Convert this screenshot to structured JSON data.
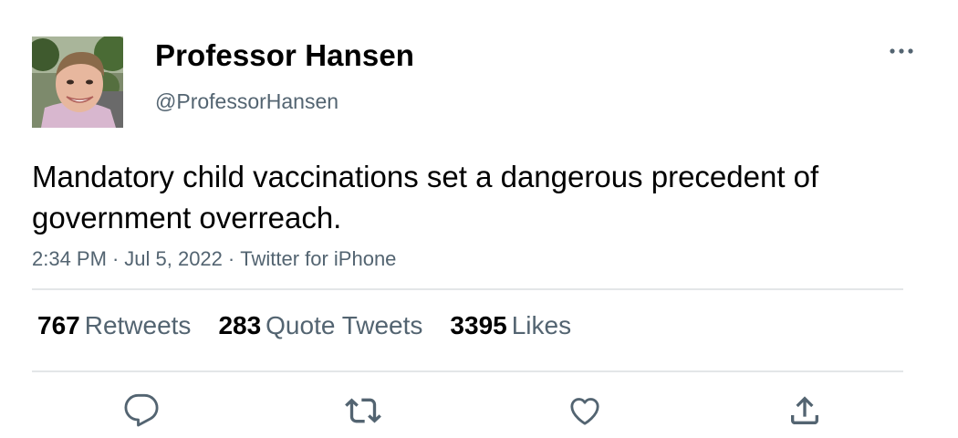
{
  "author": {
    "display_name": "Professor Hansen",
    "handle": "@ProfessorHansen",
    "avatar_icon": "profile-photo"
  },
  "tweet": {
    "text": "Mandatory child vaccinations set a dangerous precedent of government overreach.",
    "time": "2:34 PM",
    "date": "Jul 5, 2022",
    "source": "Twitter for iPhone",
    "separator": "·"
  },
  "stats": {
    "retweets": {
      "count": "767",
      "label": "Retweets"
    },
    "quote_tweets": {
      "count": "283",
      "label": "Quote Tweets"
    },
    "likes": {
      "count": "3395",
      "label": "Likes"
    }
  },
  "actions": {
    "reply_icon": "reply-icon",
    "retweet_icon": "retweet-icon",
    "like_icon": "heart-icon",
    "share_icon": "share-icon",
    "more_icon": "more-horizontal-icon"
  },
  "colors": {
    "text": "#000000",
    "secondary": "#536471",
    "divider": "#e3e6e8"
  }
}
